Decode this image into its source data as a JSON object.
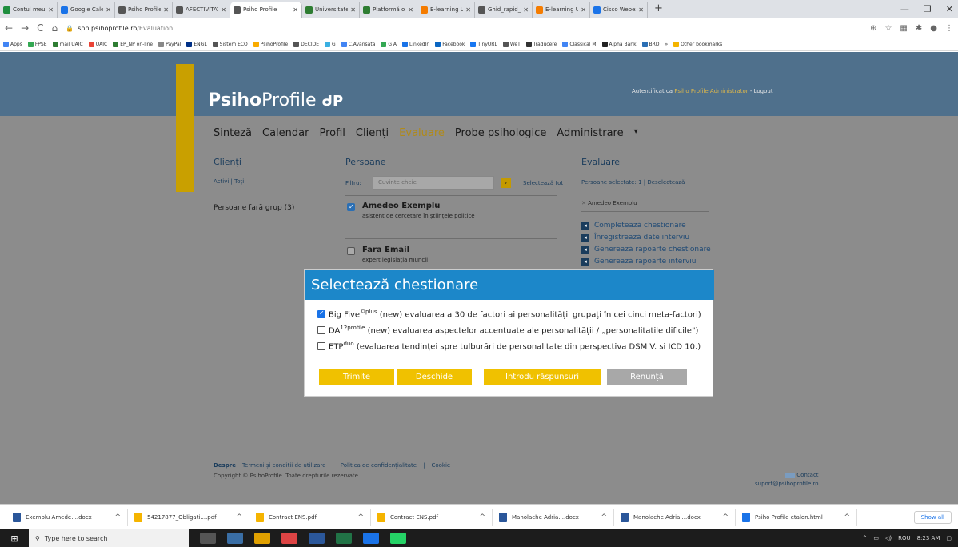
{
  "browser": {
    "tabs": [
      {
        "title": "Contul meu Drive",
        "color": "#1e8e3e"
      },
      {
        "title": "Google Calendar",
        "color": "#1a73e8"
      },
      {
        "title": "Psiho Profile",
        "color": "#555555"
      },
      {
        "title": "AFECTIVITATE / E",
        "color": "#555555"
      },
      {
        "title": "Psiho Profile",
        "color": "#555555",
        "active": true
      },
      {
        "title": "Universitatea „Al",
        "color": "#2e7d32"
      },
      {
        "title": "Platformă online",
        "color": "#2e7d32"
      },
      {
        "title": "E-learning UAIC",
        "color": "#f57c00"
      },
      {
        "title": "Ghid_rapid_Moo",
        "color": "#555555"
      },
      {
        "title": "E-learning UAIC",
        "color": "#f57c00"
      },
      {
        "title": "Cisco Webex Me",
        "color": "#1a73e8"
      }
    ],
    "new_tab": "+",
    "url_host": "spp.psihoprofile.ro",
    "url_path": "/Evaluation",
    "bookmarks": [
      "Apps",
      "FPSE",
      "mail UAIC",
      "UAIC",
      "EP_NP on-line",
      "PayPal",
      "ENGL",
      "Sistem ECO",
      "PsihoProfile",
      "DECIDE",
      "G",
      "C.Avansata",
      "G A",
      "LinkedIn",
      "Facebook",
      "TinyURL",
      "WeT",
      "Traducere",
      "Classical M",
      "Alpha Bank",
      "BRD",
      "»",
      "Other bookmarks"
    ]
  },
  "site": {
    "logo_bold": "Psiho",
    "logo_rest": "Profile",
    "auth_prefix": "Autentificat ca",
    "auth_user": "Psiho Profile Administrator",
    "auth_sep": " - ",
    "logout": "Logout",
    "menu": [
      "Sinteză",
      "Calendar",
      "Profil",
      "Clienți",
      "Evaluare",
      "Probe psihologice",
      "Administrare"
    ],
    "menu_active": "Evaluare"
  },
  "clienti": {
    "title": "Clienți",
    "activi": "Activi",
    "sep": " | ",
    "toti": "Toți",
    "grup": "Persoane fară grup (3)"
  },
  "persoane": {
    "title": "Persoane",
    "filter_label": "Filtru:",
    "filter_placeholder": "Cuvinte cheie",
    "select_all": "Selectează tot",
    "items": [
      {
        "name": "Amedeo Exemplu",
        "role": "asistent de cercetare în științele politice",
        "checked": true
      },
      {
        "name": "Fara Email",
        "role": "expert legislația muncii",
        "checked": false
      }
    ]
  },
  "evaluare": {
    "title": "Evaluare",
    "selected_label": "Persoane selectate: 1",
    "deselect": "Deselectează",
    "selected_person": "Amedeo Exemplu",
    "actions": [
      "Completează chestionare",
      "Înregistrează date interviu",
      "Generează rapoarte chestionare",
      "Generează rapoarte interviu"
    ]
  },
  "modal": {
    "title": "Selectează chestionare",
    "options": [
      {
        "name": "Big Five",
        "sup": "©plus",
        "desc": " (new) evaluarea a 30 de factori ai personalității grupați în cei cinci meta-factori)",
        "checked": true
      },
      {
        "name": "DA",
        "sup": "12profile",
        "desc": " (new) evaluarea aspectelor accentuate ale personalității / „personalitatile dificile\")",
        "checked": false
      },
      {
        "name": "ETP",
        "sup": "duo",
        "desc": " (evaluarea tendinței spre tulburări de personalitate din perspectiva DSM V. si ICD 10.)",
        "checked": false
      }
    ],
    "buttons": {
      "send": "Trimite",
      "open": "Deschide",
      "enter": "Introdu răspunsuri",
      "cancel": "Renunță"
    }
  },
  "footer": {
    "links": [
      "Despre",
      "Termeni și condiții de utilizare",
      "|",
      "Politica de confidențialitate",
      "|",
      "Cookie"
    ],
    "copyright": "Copyright © PsihoProfile. Toate drepturile rezervate.",
    "contact": "Contact",
    "email": "suport@psihoprofile.ro"
  },
  "downloads": {
    "items": [
      {
        "name": "Exemplu Amede....docx",
        "color": "#2b579a"
      },
      {
        "name": "54217877_Obligati....pdf",
        "color": "#f5b400"
      },
      {
        "name": "Contract ENS.pdf",
        "color": "#f5b400"
      },
      {
        "name": "Contract ENS.pdf",
        "color": "#f5b400"
      },
      {
        "name": "Manolache Adria....docx",
        "color": "#2b579a"
      },
      {
        "name": "Manolache Adria....docx",
        "color": "#2b579a"
      },
      {
        "name": "Psiho Profile etalon.html",
        "color": "#1a73e8"
      }
    ],
    "show_all": "Show all"
  },
  "taskbar": {
    "search_placeholder": "Type here to search",
    "lang": "ROU",
    "time": "8:23 AM"
  }
}
